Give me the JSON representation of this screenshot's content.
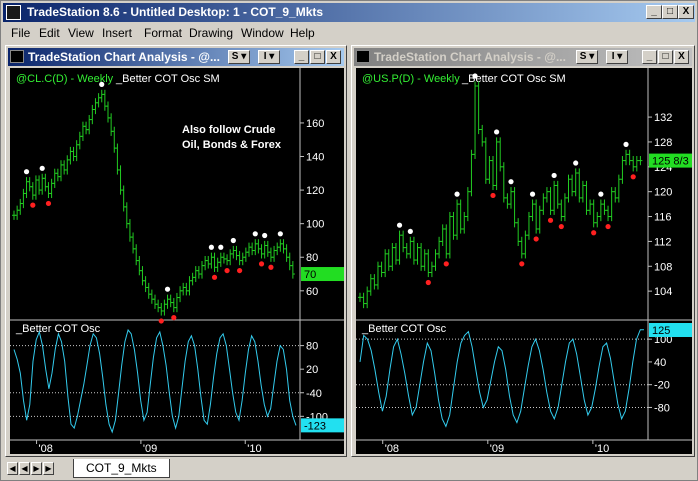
{
  "app": {
    "title": "TradeStation 8.6 - Untitled Desktop: 1 - COT_9_Mkts",
    "minimize": "_",
    "maximize": "□",
    "close": "X"
  },
  "menu": [
    "File",
    "Edit",
    "View",
    "Insert",
    "Format",
    "Drawing",
    "Window",
    "Help"
  ],
  "charts": [
    {
      "window_title": "TradeStation Chart Analysis - @...",
      "state": "active",
      "symbol_label": "@CL.C(D) - Weekly",
      "indicator_label": "_Better COT Osc SM",
      "annotation": [
        "Also follow Crude",
        "Oil, Bonds & Forex"
      ],
      "price_ticks": [
        "160",
        "140",
        "120",
        "100",
        "80",
        "60"
      ],
      "last_price": "70",
      "osc_label": "_Better COT Osc",
      "osc_ticks": [
        "80",
        "20",
        "-40",
        "-100"
      ],
      "last_osc": "-123",
      "date_ticks": [
        "'08",
        "'09",
        "'10"
      ]
    },
    {
      "window_title": "TradeStation Chart Analysis - @...",
      "state": "inactive",
      "symbol_label": "@US.P(D) - Weekly",
      "indicator_label": "_Better COT Osc SM",
      "annotation": [],
      "price_ticks": [
        "132",
        "128",
        "124",
        "120",
        "116",
        "112",
        "108",
        "104"
      ],
      "last_price": "125 8/3",
      "osc_label": "_Better COT Osc",
      "osc_ticks": [
        "100",
        "40",
        "-20",
        "-80"
      ],
      "last_osc": "125",
      "date_ticks": [
        "'08",
        "'09",
        "'10"
      ]
    }
  ],
  "chart_data": [
    {
      "type": "line",
      "symbol": "@CL.C(D) - Weekly",
      "price_range": [
        45,
        182
      ],
      "osc_range": [
        -145,
        135
      ],
      "x": [
        "'08",
        "'09",
        "'10"
      ],
      "price": [
        105,
        108,
        112,
        118,
        125,
        122,
        117,
        126,
        120,
        127,
        122,
        118,
        124,
        130,
        128,
        135,
        132,
        138,
        143,
        140,
        147,
        152,
        158,
        156,
        162,
        168,
        172,
        175,
        177,
        170,
        163,
        155,
        145,
        132,
        120,
        110,
        100,
        92,
        85,
        78,
        72,
        66,
        62,
        58,
        55,
        52,
        50,
        48,
        52,
        55,
        53,
        50,
        56,
        60,
        62,
        60,
        66,
        68,
        72,
        70,
        75,
        78,
        76,
        80,
        74,
        77,
        80,
        79,
        78,
        82,
        84,
        81,
        78,
        80,
        83,
        86,
        84,
        88,
        85,
        82,
        87,
        83,
        80,
        84,
        86,
        88,
        85,
        80,
        75,
        70
      ],
      "osc": [
        70,
        45,
        10,
        -60,
        -110,
        -70,
        40,
        95,
        115,
        80,
        20,
        -30,
        10,
        70,
        110,
        90,
        40,
        -50,
        -120,
        -130,
        -100,
        -60,
        -20,
        30,
        80,
        110,
        100,
        60,
        0,
        -70,
        -120,
        -140,
        -110,
        -40,
        30,
        90,
        120,
        110,
        70,
        10,
        -60,
        -110,
        -90,
        -20,
        50,
        100,
        115,
        80,
        30,
        -40,
        -100,
        -130,
        -100,
        -30,
        40,
        90,
        105,
        80,
        20,
        -50,
        -110,
        -120,
        -70,
        0,
        60,
        100,
        110,
        80,
        20,
        -40,
        -90,
        -110,
        -60,
        10,
        70,
        105,
        90,
        40,
        -20,
        -70,
        -100,
        -80,
        -20,
        40,
        80,
        70,
        20,
        -60,
        -100,
        -123
      ]
    },
    {
      "type": "line",
      "symbol": "@US.P(D) - Weekly",
      "price_range": [
        100,
        137
      ],
      "osc_range": [
        -150,
        140
      ],
      "x": [
        "'08",
        "'09",
        "'10"
      ],
      "price": [
        103,
        102,
        104,
        106,
        105,
        108,
        107,
        110,
        108,
        111,
        109,
        113,
        111,
        110,
        112,
        109,
        111,
        108,
        110,
        107,
        108,
        110,
        112,
        114,
        110,
        116,
        113,
        118,
        114,
        116,
        120,
        126,
        137,
        130,
        128,
        122,
        125,
        121,
        128,
        124,
        119,
        118,
        120,
        115,
        112,
        110,
        113,
        116,
        118,
        114,
        117,
        119,
        120,
        117,
        121,
        118,
        116,
        119,
        122,
        120,
        123,
        119,
        121,
        117,
        118,
        115,
        116,
        118,
        117,
        116,
        120,
        119,
        122,
        125,
        126,
        125,
        124,
        125,
        125
      ],
      "osc": [
        40,
        110,
        100,
        70,
        20,
        -40,
        -90,
        -50,
        20,
        80,
        100,
        60,
        10,
        -50,
        -100,
        -80,
        -20,
        40,
        90,
        70,
        10,
        -60,
        -110,
        -130,
        -100,
        -30,
        40,
        90,
        110,
        120,
        80,
        20,
        -40,
        -80,
        -60,
        -10,
        40,
        80,
        70,
        20,
        -50,
        -100,
        -120,
        -90,
        -30,
        30,
        80,
        100,
        70,
        20,
        -40,
        -90,
        -110,
        -80,
        -20,
        40,
        90,
        100,
        60,
        0,
        -60,
        -100,
        -80,
        -30,
        30,
        80,
        90,
        50,
        -10,
        -70,
        -110,
        -90,
        -30,
        40,
        100,
        125,
        125
      ]
    }
  ]
}
